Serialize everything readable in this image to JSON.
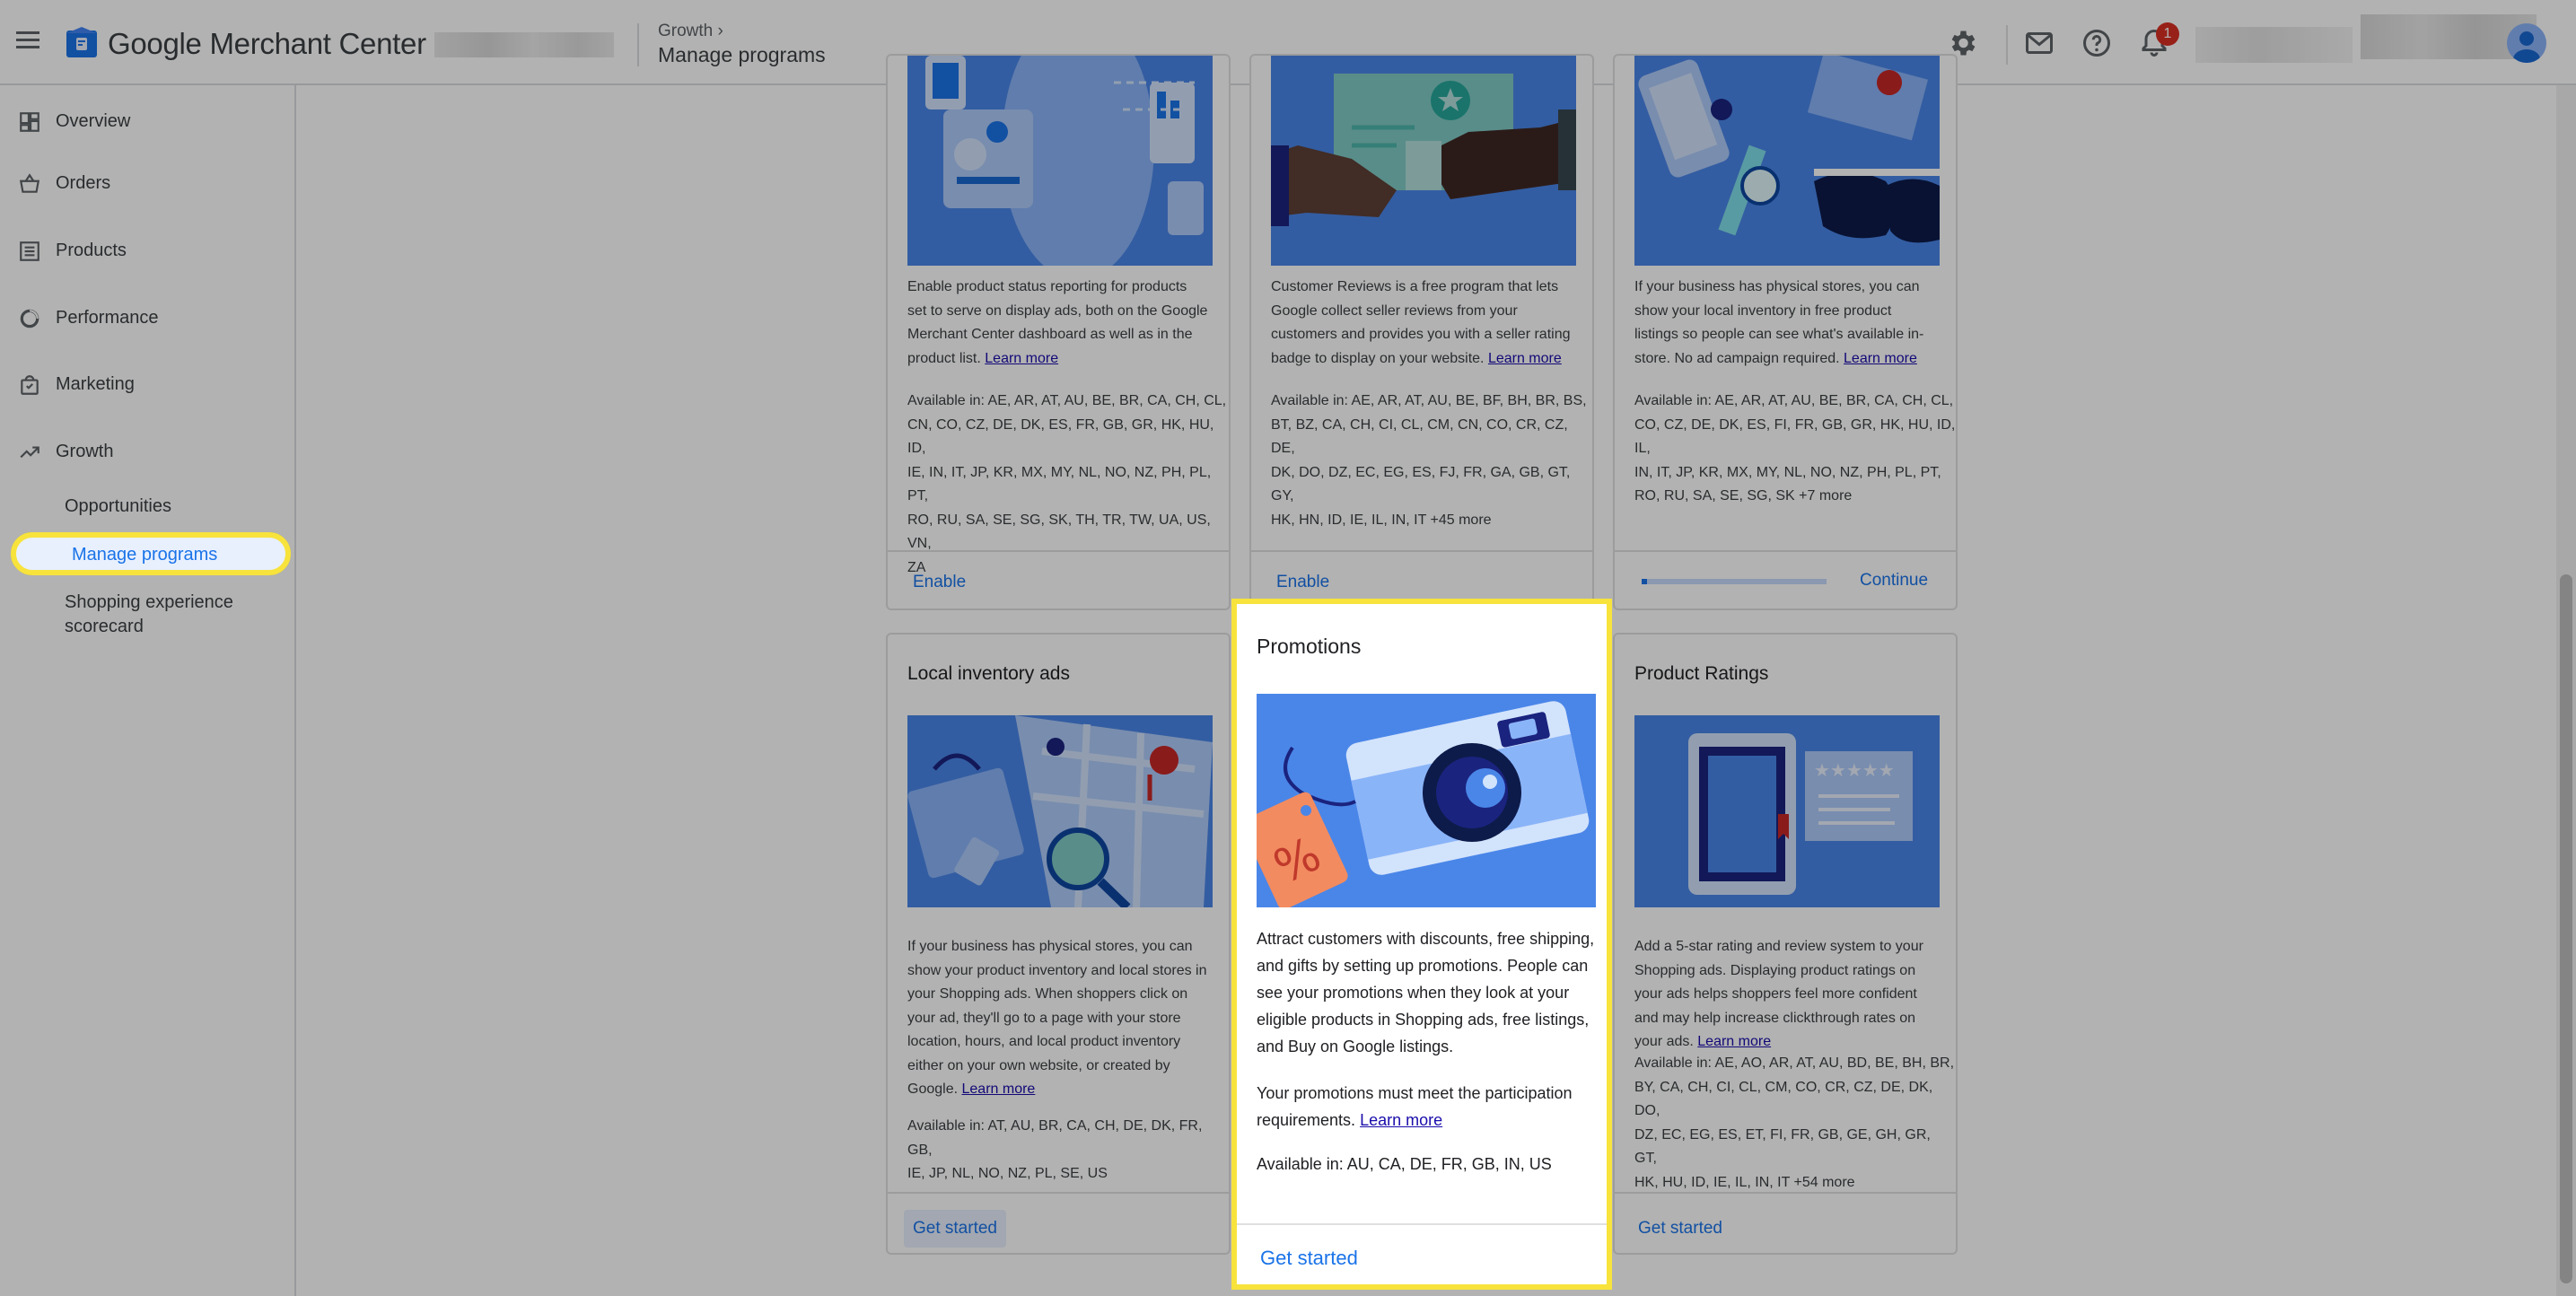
{
  "app": {
    "title": "Google Merchant Center"
  },
  "breadcrumb": {
    "parent": "Growth",
    "current": "Manage programs"
  },
  "topbar": {
    "notification_count": "1"
  },
  "sidebar": {
    "items": [
      {
        "label": "Overview",
        "icon": "dashboard-icon"
      },
      {
        "label": "Orders",
        "icon": "basket-icon"
      },
      {
        "label": "Products",
        "icon": "list-icon"
      },
      {
        "label": "Performance",
        "icon": "donut-chart-icon"
      },
      {
        "label": "Marketing",
        "icon": "shopping-bag-icon"
      },
      {
        "label": "Growth",
        "icon": "trending-up-icon"
      }
    ],
    "growth_sub": {
      "opportunities": "Opportunities",
      "manage_programs": "Manage programs",
      "shopping_experience_1": "Shopping experience",
      "shopping_experience_2": "scorecard"
    }
  },
  "cards": {
    "dynamic_remarketing": {
      "desc": [
        "Enable product status reporting for products",
        "set to serve on display ads, both on the Google",
        "Merchant Center dashboard as well as in the",
        "product list."
      ],
      "learn_more": "Learn more",
      "avail": [
        "Available in: AE, AR, AT, AU, BE, BR, CA, CH, CL,",
        "CN, CO, CZ, DE, DK, ES, FR, GB, GR, HK, HU, ID,",
        "IE, IN, IT, JP, KR, MX, MY, NL, NO, NZ, PH, PL, PT,",
        "RO, RU, SA, SE, SG, SK, TH, TR, TW, UA, US, VN,",
        "ZA"
      ],
      "action": "Enable"
    },
    "customer_reviews": {
      "desc": [
        "Customer Reviews is a free program that lets",
        "Google collect seller reviews from your",
        "customers and provides you with a seller rating",
        "badge to display on your website."
      ],
      "learn_more": "Learn more",
      "avail": [
        "Available in: AE, AR, AT, AU, BE, BF, BH, BR, BS,",
        "BT, BZ, CA, CH, CI, CL, CM, CN, CO, CR, CZ, DE,",
        "DK, DO, DZ, EC, EG, ES, FJ, FR, GA, GB, GT, GY,",
        "HK, HN, ID, IE, IL, IN, IT +45 more"
      ],
      "action": "Enable"
    },
    "free_local_listings": {
      "desc": [
        "If your business has physical stores, you can",
        "show your local inventory in free product",
        "listings so people can see what's available in-",
        "store. No ad campaign required."
      ],
      "learn_more": "Learn more",
      "avail": [
        "Available in: AE, AR, AT, AU, BE, BR, CA, CH, CL,",
        "CO, CZ, DE, DK, ES, FI, FR, GB, GR, HK, HU, ID, IL,",
        "IN, IT, JP, KR, MX, MY, NL, NO, NZ, PH, PL, PT,",
        "RO, RU, SA, SE, SG, SK +7 more"
      ],
      "action": "Continue",
      "progress": 0.03
    },
    "local_inventory_ads": {
      "title": "Local inventory ads",
      "desc": [
        "If your business has physical stores, you can",
        "show your product inventory and local stores in",
        "your Shopping ads. When shoppers click on",
        "your ad, they'll go to a page with your store",
        "location, hours, and local product inventory",
        "either on your own website, or created by",
        "Google."
      ],
      "learn_more": "Learn more",
      "avail": [
        "Available in: AT, AU, BR, CA, CH, DE, DK, FR, GB,",
        "IE, JP, NL, NO, NZ, PL, SE, US"
      ],
      "action": "Get started"
    },
    "promotions": {
      "title": "Promotions",
      "desc": [
        "Attract customers with discounts, free shipping,",
        "and gifts by setting up promotions. People can",
        "see your promotions when they look at your",
        "eligible products in Shopping ads, free listings,",
        "and Buy on Google listings."
      ],
      "req": [
        "Your promotions must meet the participation",
        "requirements."
      ],
      "learn_more": "Learn more",
      "avail": "Available in: AU, CA, DE, FR, GB, IN, US",
      "action": "Get started"
    },
    "product_ratings": {
      "title": "Product Ratings",
      "desc": [
        "Add a 5-star rating and review system to your",
        "Shopping ads. Displaying product ratings on",
        "your ads helps shoppers feel more confident",
        "and may help increase clickthrough rates on",
        "your ads."
      ],
      "learn_more": "Learn more",
      "avail": [
        "Available in: AE, AO, AR, AT, AU, BD, BE, BH, BR,",
        "BY, CA, CH, CI, CL, CM, CO, CR, CZ, DE, DK, DO,",
        "DZ, EC, EG, ES, ET, FI, FR, GB, GE, GH, GR, GT,",
        "HK, HU, ID, IE, IL, IN, IT +54 more"
      ],
      "action": "Get started"
    }
  },
  "colors": {
    "accent": "#1a73e8",
    "highlight": "#f7e33c",
    "illustration_blue": "#4a86e8"
  }
}
